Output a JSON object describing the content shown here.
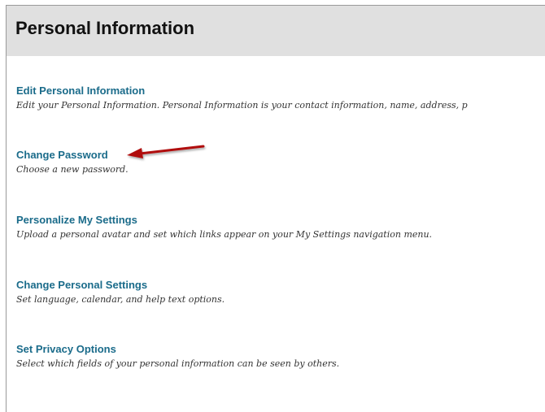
{
  "page": {
    "title": "Personal Information"
  },
  "items": [
    {
      "link": "Edit Personal Information",
      "description": "Edit your Personal Information. Personal Information is your contact information, name, address, p"
    },
    {
      "link": "Change Password",
      "description": "Choose a new password."
    },
    {
      "link": "Personalize My Settings",
      "description": "Upload a personal avatar and set which links appear on your My Settings navigation menu."
    },
    {
      "link": "Change Personal Settings",
      "description": "Set language, calendar, and help text options."
    },
    {
      "link": "Set Privacy Options",
      "description": "Select which fields of your personal information can be seen by others."
    }
  ],
  "colors": {
    "link": "#1a6b8a",
    "header_bg": "#e0e0e0",
    "arrow": "#b01010"
  },
  "annotation": {
    "icon": "red-pointer-arrow-icon"
  }
}
